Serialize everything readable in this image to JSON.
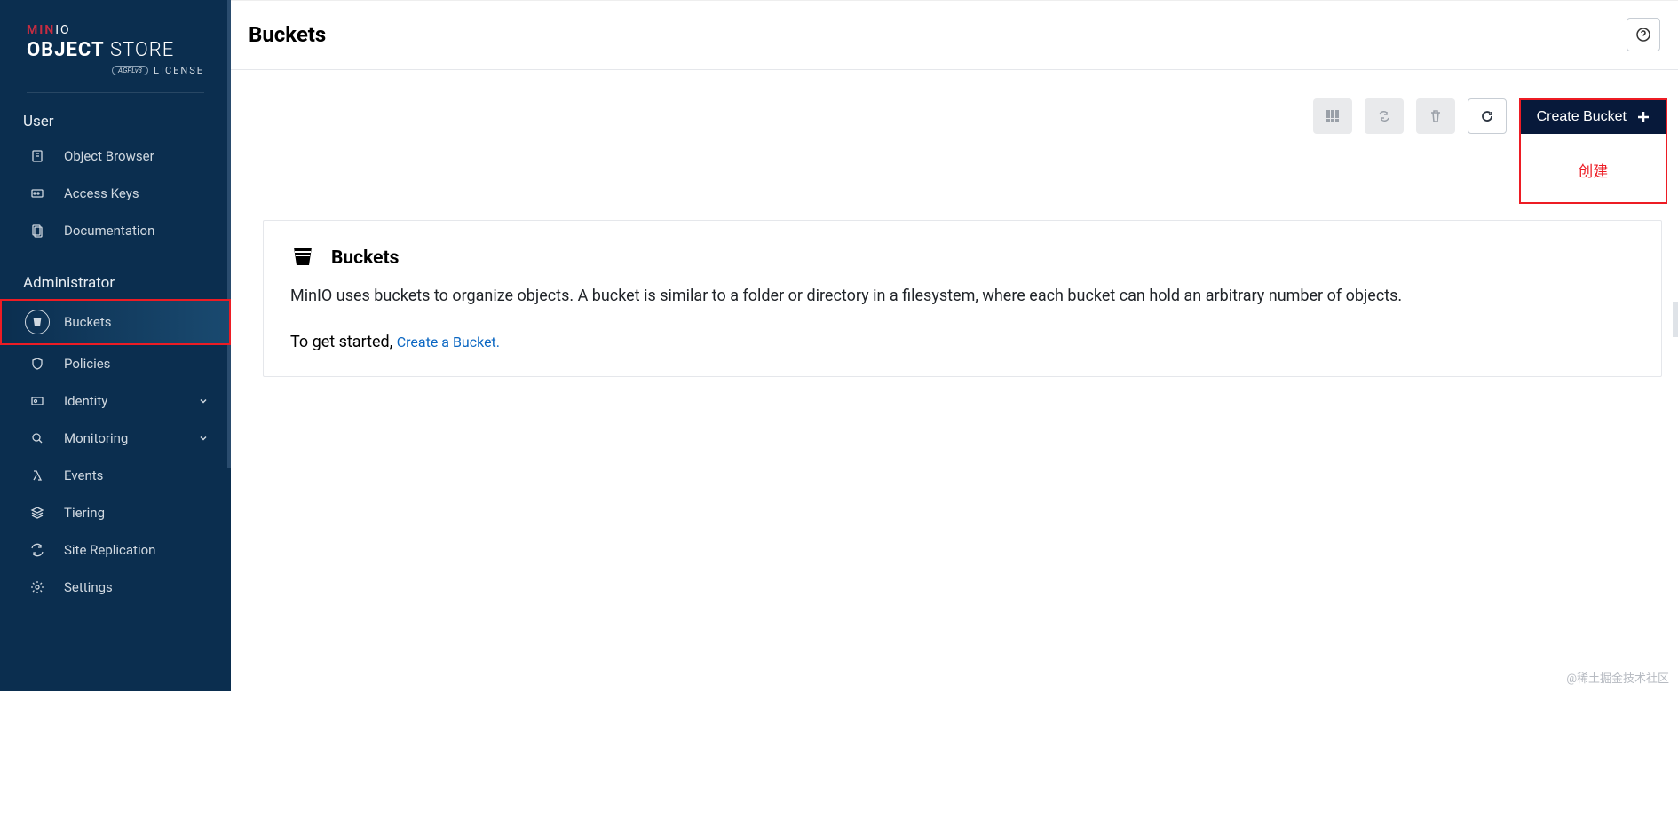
{
  "logo": {
    "brand_prefix": "MIN",
    "brand_suffix": "IO",
    "product_bold": "OBJECT",
    "product_light": " STORE",
    "license_badge": "AGPLv3",
    "license_text": "LICENSE"
  },
  "sidebar": {
    "sections": {
      "user": {
        "label": "User",
        "items": [
          {
            "label": "Object Browser"
          },
          {
            "label": "Access Keys"
          },
          {
            "label": "Documentation"
          }
        ]
      },
      "admin": {
        "label": "Administrator",
        "items": [
          {
            "label": "Buckets"
          },
          {
            "label": "Policies"
          },
          {
            "label": "Identity"
          },
          {
            "label": "Monitoring"
          },
          {
            "label": "Events"
          },
          {
            "label": "Tiering"
          },
          {
            "label": "Site Replication"
          },
          {
            "label": "Settings"
          }
        ]
      }
    }
  },
  "page": {
    "title": "Buckets"
  },
  "toolbar": {
    "create_label": "Create Bucket",
    "annotation": "创建"
  },
  "card": {
    "title": "Buckets",
    "description": "MinIO uses buckets to organize objects. A bucket is similar to a folder or directory in a filesystem, where each bucket can hold an arbitrary number of objects.",
    "cta_prefix": "To get started, ",
    "cta_link": "Create a Bucket."
  },
  "watermark": "@稀土掘金技术社区"
}
